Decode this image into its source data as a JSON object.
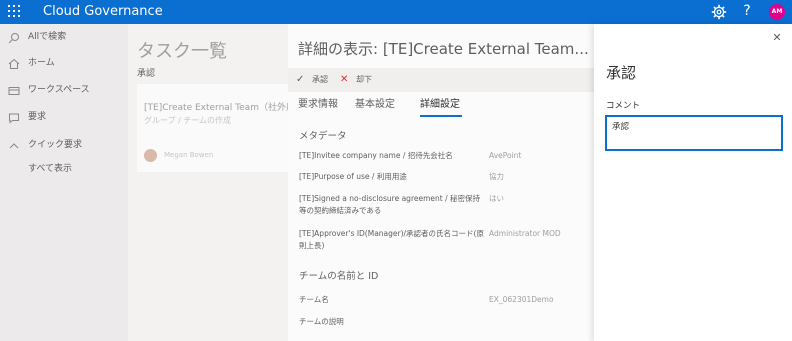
{
  "app": {
    "title": "Cloud Governance",
    "avatar_initials": "AM",
    "accent": "#0a6fd1",
    "avatar_color": "#e3008c"
  },
  "nav": {
    "items": [
      {
        "label": "Allで検索",
        "icon": "search-icon"
      },
      {
        "label": "ホーム",
        "icon": "home-icon"
      },
      {
        "label": "ワークスペース",
        "icon": "workspace-icon"
      },
      {
        "label": "要求",
        "icon": "request-icon"
      },
      {
        "label": "クイック要求",
        "icon": "chevron-up-icon"
      },
      {
        "label": "すべて表示",
        "icon": ""
      }
    ]
  },
  "main": {
    "title": "タスク一覧",
    "section": "承認",
    "task": {
      "title": "[TE]Create External Team（社外用チ",
      "subtitle": "グループ / チームの作成",
      "user": "Megan Bowen"
    }
  },
  "detail": {
    "title": "詳細の表示: [TE]Create External Team...",
    "commands": {
      "approve": "承認",
      "reject": "却下"
    },
    "tabs": [
      "要求情報",
      "基本設定",
      "詳細設定"
    ],
    "active_tab": 2,
    "metadata_heading": "メタデータ",
    "fields": [
      {
        "label": "[TE]Invitee company name / 招待先会社名",
        "value": "AvePoint"
      },
      {
        "label": "[TE]Purpose of use / 利用用途",
        "value": "協力"
      },
      {
        "label": "[TE]Signed a no-disclosure agreement / 秘密保持等の契約締結済みである",
        "value": "はい"
      },
      {
        "label": "[TE]Approver's ID(Manager)/承認者の氏名コード(原則上長)",
        "value": "Administrator MOD"
      }
    ],
    "team_heading": "チームの名前と ID",
    "team_fields": [
      {
        "label": "チーム名",
        "value": "EX_062301Demo"
      },
      {
        "label": "チームの説明",
        "value": ""
      }
    ]
  },
  "approve_panel": {
    "title": "承認",
    "comment_label": "コメント",
    "comment_value": "承認"
  }
}
